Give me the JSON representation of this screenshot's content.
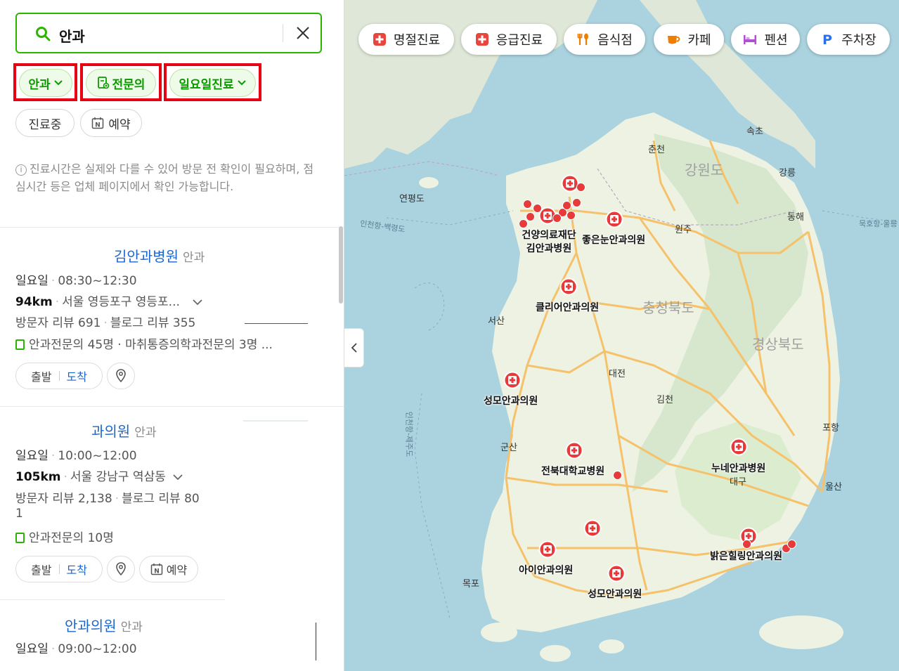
{
  "search": {
    "query": "안과"
  },
  "filters": {
    "chip_category": "안과",
    "chip_specialist": "전문의",
    "chip_sunday": "일요일진료",
    "chip_open": "진료중",
    "chip_reserve": "예약"
  },
  "notice": "진료시간은 실제와 다를 수 있어 방문 전 확인이 필요하며, 점심시간 등은 업체 페이지에서 확인 가능합니다.",
  "results": [
    {
      "name": "김안과병원",
      "category": "안과",
      "day": "일요일",
      "hours": "08:30~12:30",
      "distance": "94km",
      "address": "서울 영등포구 영등포...",
      "visitor_reviews": "방문자 리뷰 691",
      "blog_reviews": "블로그 리뷰 355",
      "specialists": "안과전문의 45명 · 마취통증의학과전문의 3명 ...",
      "btn_depart": "출발",
      "btn_arrive": "도착"
    },
    {
      "name": "과의원",
      "category": "안과",
      "day": "일요일",
      "hours": "10:00~12:00",
      "distance": "105km",
      "address": "서울 강남구 역삼동",
      "visitor_reviews": "방문자 리뷰 2,138",
      "blog_reviews": "블로그 리뷰 80",
      "blog_reviews_wrap": "1",
      "specialists": "안과전문의 10명",
      "btn_depart": "출발",
      "btn_arrive": "도착",
      "btn_reserve": "예약"
    },
    {
      "name": "안과의원",
      "category": "안과",
      "day": "일요일",
      "hours": "09:00~12:00"
    }
  ],
  "map_chips": [
    {
      "label": "명절진료",
      "icon": "medical-cross-icon",
      "color": "#e8453c"
    },
    {
      "label": "응급진료",
      "icon": "medical-cross-icon",
      "color": "#e8453c"
    },
    {
      "label": "음식점",
      "icon": "fork-spoon-icon",
      "color": "#f07d00"
    },
    {
      "label": "카페",
      "icon": "coffee-cup-icon",
      "color": "#f07d00"
    },
    {
      "label": "펜션",
      "icon": "bed-icon",
      "color": "#b14fd8"
    },
    {
      "label": "주차장",
      "icon": "parking-icon",
      "color": "#2a6ff0"
    }
  ],
  "map": {
    "cities": [
      "속초",
      "춘천",
      "강릉",
      "연평도",
      "동해",
      "원주",
      "서산",
      "대전",
      "김천",
      "포항",
      "군산",
      "대구",
      "울산",
      "목포",
      "인천항-백령도",
      "묵호항-울릉"
    ],
    "regions": [
      "강원도",
      "충청북도",
      "경상북도"
    ],
    "sea_route": "인천항-제주도",
    "places": [
      "건양의료재단 김안과병원",
      "좋은눈안과의원",
      "클리어안과의원",
      "성모안과의원",
      "전북대학교병원",
      "누네안과병원",
      "아이안과의원",
      "성모안과의원",
      "밝은힐링안과의원"
    ]
  },
  "colors": {
    "brand_green": "#2db400",
    "link_blue": "#1a66cc",
    "highlight_red": "#e60012",
    "pin_red": "#e83a3a"
  }
}
